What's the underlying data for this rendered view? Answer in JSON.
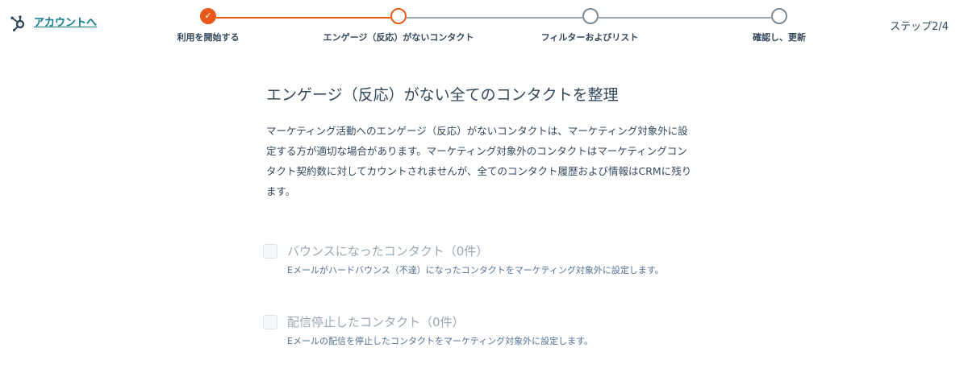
{
  "header": {
    "back_label": "アカウントへ",
    "step_counter": "ステップ2/4"
  },
  "stepper": {
    "steps": [
      {
        "label": "利用を開始する",
        "state": "done"
      },
      {
        "label": "エンゲージ（反応）がないコンタクト",
        "state": "current"
      },
      {
        "label": "フィルターおよびリスト",
        "state": "todo"
      },
      {
        "label": "確認し、更新",
        "state": "todo"
      }
    ]
  },
  "main": {
    "title": "エンゲージ（反応）がない全てのコンタクトを整理",
    "description": "マーケティング活動へのエンゲージ（反応）がないコンタクトは、マーケティング対象外に設定する方が適切な場合があります。マーケティング対象外のコンタクトはマーケティングコンタクト契約数に対してカウントされませんが、全てのコンタクト履歴および情報はCRMに残ります。",
    "options": [
      {
        "label": "バウンスになったコンタクト（0件）",
        "description": "Eメールがハードバウンス（不達）になったコンタクトをマーケティング対象外に設定します。",
        "checked": false,
        "disabled": true
      },
      {
        "label": "配信停止したコンタクト（0件）",
        "description": "Eメールの配信を停止したコンタクトをマーケティング対象外に設定します。",
        "checked": false,
        "disabled": true
      }
    ]
  },
  "colors": {
    "accent": "#e8591a",
    "link": "#0b7a8a",
    "text": "#33475b",
    "muted": "#99a7b5"
  }
}
